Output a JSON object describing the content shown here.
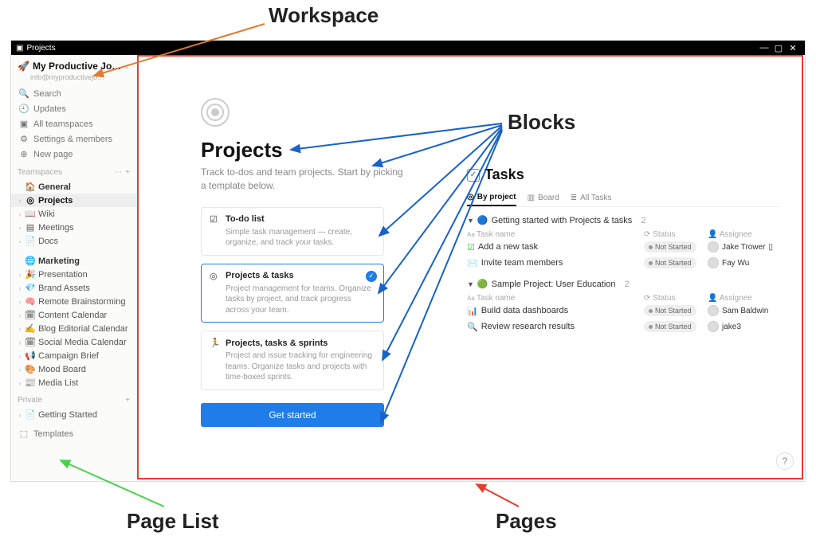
{
  "annotations": {
    "workspace": "Workspace",
    "blocks": "Blocks",
    "page_list": "Page List",
    "pages": "Pages"
  },
  "window": {
    "title": "Projects"
  },
  "workspace": {
    "name": "My Productive Jo…",
    "email": "info@myproductivejo…"
  },
  "nav": {
    "search": "Search",
    "updates": "Updates",
    "teamspaces": "All teamspaces",
    "settings": "Settings & members",
    "new_page": "New page"
  },
  "sections": {
    "teamspaces": "Teamspaces",
    "private": "Private",
    "templates": "Templates"
  },
  "general": {
    "label": "General",
    "pages": {
      "projects": "Projects",
      "wiki": "Wiki",
      "meetings": "Meetings",
      "docs": "Docs"
    }
  },
  "marketing": {
    "label": "Marketing",
    "pages": {
      "presentation": "Presentation",
      "brand_assets": "Brand Assets",
      "remote_brainstorming": "Remote Brainstorming",
      "content_calendar": "Content Calendar",
      "blog_editorial": "Blog Editorial Calendar",
      "social_media": "Social Media Calendar",
      "campaign_brief": "Campaign Brief",
      "mood_board": "Mood Board",
      "media_list": "Media List"
    }
  },
  "private_pages": {
    "getting_started": "Getting Started"
  },
  "page": {
    "title": "Projects",
    "subtitle": "Track to-dos and team projects. Start by picking a template below.",
    "get_started": "Get started"
  },
  "templates": {
    "todo": {
      "title": "To-do list",
      "desc": "Simple task management — create, organize, and track your tasks."
    },
    "projects_tasks": {
      "title": "Projects & tasks",
      "desc": "Project management for teams. Organize tasks by project, and track progress across your team."
    },
    "sprints": {
      "title": "Projects, tasks & sprints",
      "desc": "Project and issue tracking for engineering teams. Organize tasks and projects with time-boxed sprints."
    }
  },
  "tasks": {
    "title": "Tasks",
    "tabs": {
      "by_project": "By project",
      "board": "Board",
      "all": "All Tasks"
    },
    "columns": {
      "name": "Task name",
      "status": "Status",
      "assignee": "Assignee"
    },
    "group1": {
      "title": "Getting started with Projects & tasks",
      "count": "2",
      "rows": {
        "r1": {
          "name": "Add a new task",
          "status": "Not Started",
          "assignee": "Jake Trower"
        },
        "r2": {
          "name": "Invite team members",
          "status": "Not Started",
          "assignee": "Fay Wu"
        }
      }
    },
    "group2": {
      "title": "Sample Project: User Education",
      "count": "2",
      "rows": {
        "r1": {
          "name": "Build data dashboards",
          "status": "Not Started",
          "assignee": "Sam Baldwin"
        },
        "r2": {
          "name": "Review research results",
          "status": "Not Started",
          "assignee": "jake3"
        }
      }
    }
  }
}
